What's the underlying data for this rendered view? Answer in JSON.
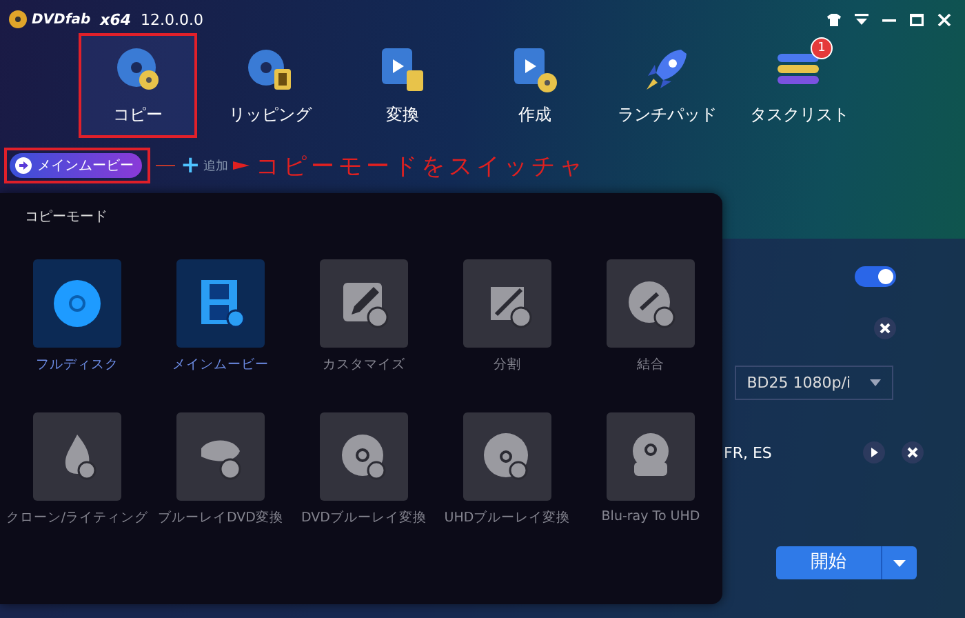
{
  "app": {
    "logo": "DVDfab",
    "arch": "x64",
    "version": "12.0.0.0"
  },
  "tabs": [
    {
      "label": "コピー",
      "selected": true,
      "kind": "copy"
    },
    {
      "label": "リッピング",
      "selected": false,
      "kind": "ripper"
    },
    {
      "label": "変換",
      "selected": false,
      "kind": "convert"
    },
    {
      "label": "作成",
      "selected": false,
      "kind": "create"
    },
    {
      "label": "ランチパッド",
      "selected": false,
      "kind": "launch"
    },
    {
      "label": "タスクリスト",
      "selected": false,
      "kind": "tasks",
      "badge": "1"
    }
  ],
  "mode_button": {
    "label": "メインムービー"
  },
  "add_button": {
    "icon": "+",
    "label": "追加"
  },
  "annotation": {
    "text": "コピーモードをスイッチャ"
  },
  "copy_mode_menu": {
    "title": "コピーモード",
    "modes": [
      {
        "label": "フルディスク",
        "kind": "disc",
        "disabled": false
      },
      {
        "label": "メインムービー",
        "kind": "film",
        "disabled": false
      },
      {
        "label": "カスタマイズ",
        "kind": "edit",
        "disabled": true
      },
      {
        "label": "分割",
        "kind": "split",
        "disabled": true
      },
      {
        "label": "結合",
        "kind": "merge",
        "disabled": true
      },
      {
        "label": "クローン/ライティング",
        "kind": "burn",
        "disabled": true
      },
      {
        "label": "ブルーレイDVD変換",
        "kind": "bd",
        "disabled": true
      },
      {
        "label": "DVDブルーレイ変換",
        "kind": "dvdbd",
        "disabled": true
      },
      {
        "label": "UHDブルーレイ変換",
        "kind": "uhdbd",
        "disabled": true
      },
      {
        "label": "Blu-ray To UHD",
        "kind": "uhd",
        "disabled": true
      }
    ]
  },
  "settings": {
    "toggle": {
      "on": true
    },
    "profile_select": {
      "value": "BD25 1080p/i"
    },
    "audio": {
      "text": "FR, ES"
    }
  },
  "start_button": {
    "label": "開始"
  }
}
